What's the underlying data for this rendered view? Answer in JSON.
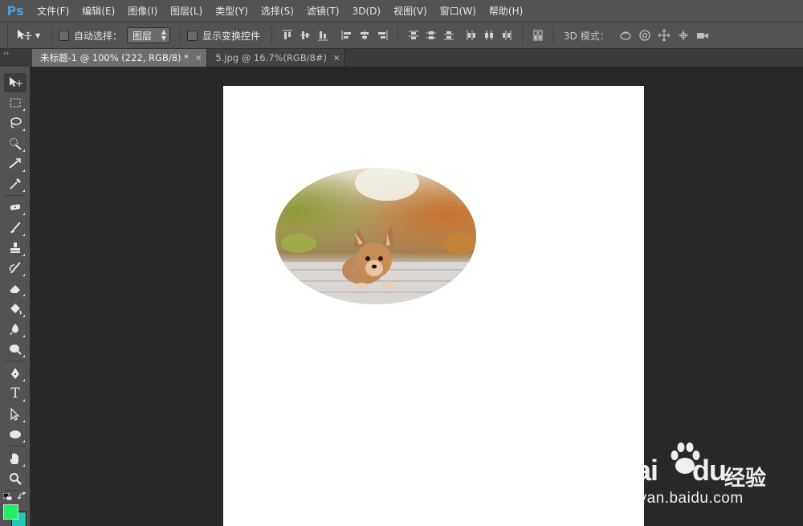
{
  "app": {
    "logo": "Ps"
  },
  "menu": [
    "文件(F)",
    "编辑(E)",
    "图像(I)",
    "图层(L)",
    "类型(Y)",
    "选择(S)",
    "滤镜(T)",
    "3D(D)",
    "视图(V)",
    "窗口(W)",
    "帮助(H)"
  ],
  "options": {
    "auto_select_label": "自动选择：",
    "auto_select_checked": false,
    "auto_select_target": "图层",
    "show_transform_label": "显示变换控件",
    "show_transform_checked": false,
    "mode3d_label": "3D 模式："
  },
  "tabs": [
    {
      "label": "未标题-1 @ 100% (222, RGB/8) *",
      "active": true,
      "close": "×"
    },
    {
      "label": "5.jpg @ 16.7%(RGB/8#)",
      "active": false,
      "close": "×"
    }
  ],
  "tools": {
    "grip": "››",
    "type_tool": "T"
  },
  "colors": {
    "foreground": "#22ee66",
    "background": "#20c9b3",
    "canvas": "#ffffff",
    "workspace": "#282828",
    "ui": "#535353"
  },
  "watermark": {
    "brand_a": "Bai",
    "brand_b": "du",
    "suffix": "经验",
    "url": "jingyan.baidu.com"
  }
}
